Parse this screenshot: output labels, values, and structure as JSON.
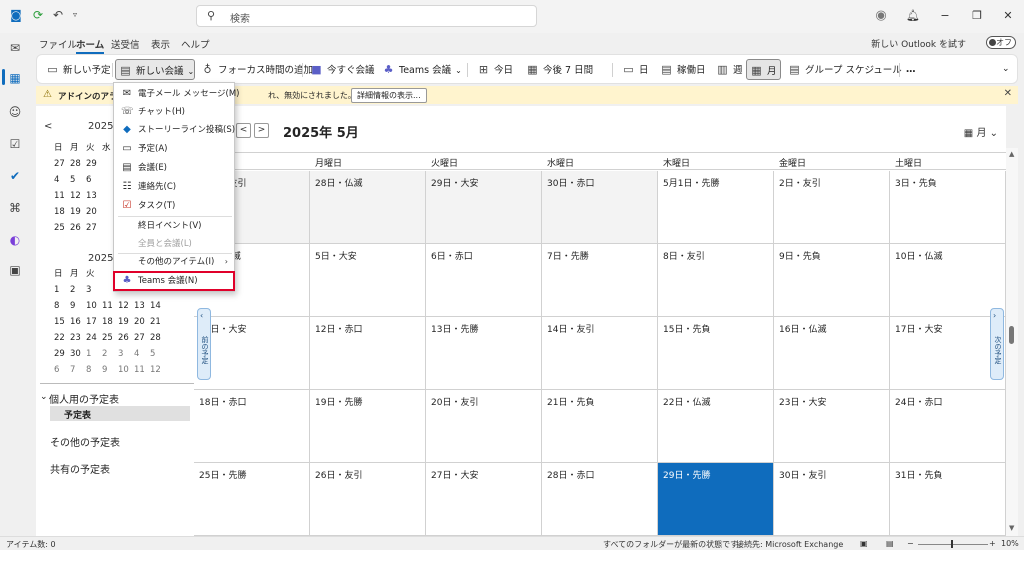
{
  "titlebar": {
    "search_placeholder": "検索",
    "icons": [
      "outlook-logo",
      "sync-icon",
      "undo-icon",
      "customize-icon",
      "avatar",
      "bell-icon",
      "minimize-icon",
      "restore-icon",
      "close-icon"
    ]
  },
  "menubar": {
    "tabs": [
      "ファイル",
      "ホーム",
      "送受信",
      "表示",
      "ヘルプ"
    ],
    "active_tab": "ホーム",
    "try_new_outlook": "新しい Outlook を試す",
    "toggle_label": "オフ"
  },
  "ribbon": {
    "new_appointment": "新しい予定",
    "new_meeting": "新しい会議",
    "focus_time": "フォーカス時間の追加",
    "meet_now": "今すぐ会議",
    "teams_meeting": "Teams 会議",
    "today": "今日",
    "next_7_days": "今後 7 日間",
    "day": "日",
    "work_week": "稼働日",
    "week": "週",
    "month": "月",
    "group_schedule": "グループ スケジュール",
    "more": "…"
  },
  "infobar": {
    "label": "アドインのアラー",
    "message": "れ、無効にされました。",
    "details_button": "詳細情報の表示..."
  },
  "dropdown": {
    "email_message": "電子メール メッセージ(M)",
    "chat": "チャット(H)",
    "storyline_post": "ストーリーライン投稿(S)",
    "appointment": "予定(A)",
    "meeting": "会議(E)",
    "contact": "連絡先(C)",
    "task": "タスク(T)",
    "all_day_event": "終日イベント(V)",
    "all_hands": "全員と会議(L)",
    "other_items": "その他のアイテム(I)",
    "teams_meeting": "Teams 会議(N)"
  },
  "mini_calendar": {
    "prev_label": "<",
    "month1_title": "2025",
    "month2_title": "2025",
    "weekdays": [
      "日",
      "月",
      "火",
      "水",
      "木",
      "金",
      "土"
    ],
    "month1_rows": [
      [
        "27",
        "28",
        "29",
        "",
        "",
        "",
        ""
      ],
      [
        "4",
        "5",
        "6",
        "",
        "",
        "",
        ""
      ],
      [
        "11",
        "12",
        "13",
        "",
        "",
        "",
        ""
      ],
      [
        "18",
        "19",
        "20",
        "",
        "",
        "",
        ""
      ],
      [
        "25",
        "26",
        "27",
        "",
        "",
        "",
        ""
      ]
    ],
    "month2_weekdays": [
      "日",
      "月",
      "火",
      "",
      "",
      "",
      ""
    ],
    "month2_rows": [
      [
        "1",
        "2",
        "3",
        "",
        "",
        "",
        ""
      ],
      [
        "8",
        "9",
        "10",
        "11",
        "12",
        "13",
        "14"
      ],
      [
        "15",
        "16",
        "17",
        "18",
        "19",
        "20",
        "21"
      ],
      [
        "22",
        "23",
        "24",
        "25",
        "26",
        "27",
        "28"
      ],
      [
        "29",
        "30",
        "1",
        "2",
        "3",
        "4",
        "5"
      ],
      [
        "6",
        "7",
        "8",
        "9",
        "10",
        "11",
        "12"
      ]
    ]
  },
  "folders": {
    "my_calendars": "個人用の予定表",
    "calendar": "予定表",
    "other_calendars": "その他の予定表",
    "shared_calendars": "共有の予定表"
  },
  "calendar": {
    "title": "2025年 5月",
    "view_label": "月",
    "prev_appointment": "前の予定",
    "next_appointment": "次の予定",
    "weekdays": [
      "日曜日",
      "月曜日",
      "火曜日",
      "水曜日",
      "木曜日",
      "金曜日",
      "土曜日"
    ],
    "weeks": [
      [
        "27日・友引",
        "28日・仏滅",
        "29日・大安",
        "30日・赤口",
        "5月1日・先勝",
        "2日・友引",
        "3日・先負"
      ],
      [
        "4日・仏滅",
        "5日・大安",
        "6日・赤口",
        "7日・先勝",
        "8日・友引",
        "9日・先負",
        "10日・仏滅"
      ],
      [
        "11日・大安",
        "12日・赤口",
        "13日・先勝",
        "14日・友引",
        "15日・先負",
        "16日・仏滅",
        "17日・大安"
      ],
      [
        "18日・赤口",
        "19日・先勝",
        "20日・友引",
        "21日・先負",
        "22日・仏滅",
        "23日・大安",
        "24日・赤口"
      ],
      [
        "25日・先勝",
        "26日・友引",
        "27日・大安",
        "28日・赤口",
        "29日・先勝",
        "30日・友引",
        "31日・先負"
      ]
    ],
    "today_color": "#0f6cbd"
  },
  "statusbar": {
    "item_count": "アイテム数: 0",
    "folders_status": "すべてのフォルダーが最新の状態です。",
    "connection": "接続先: Microsoft Exchange",
    "zoom": "10%"
  },
  "colors": {
    "accent": "#0f6cbd",
    "highlight_box": "#e0002a",
    "infobar": "#fff4ce"
  }
}
